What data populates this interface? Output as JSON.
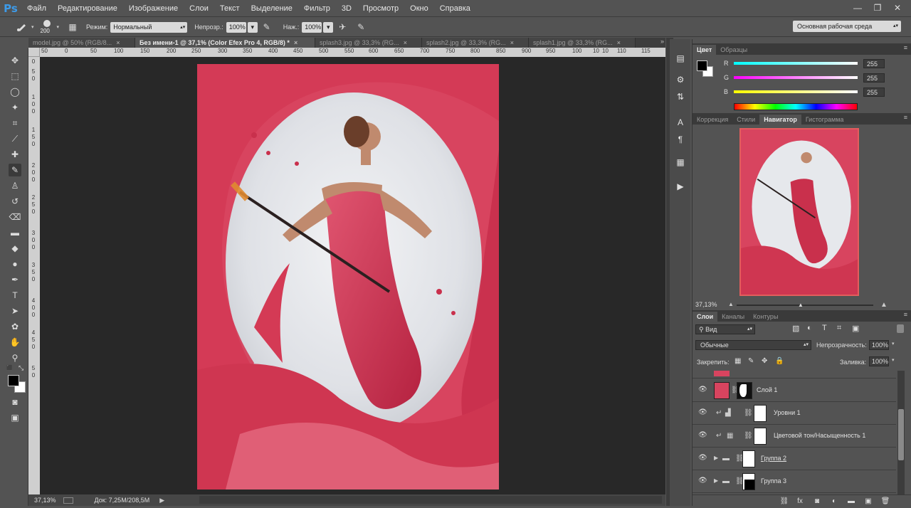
{
  "app": {
    "logo": "Ps"
  },
  "menu": [
    "Файл",
    "Редактирование",
    "Изображение",
    "Слои",
    "Текст",
    "Выделение",
    "Фильтр",
    "3D",
    "Просмотр",
    "Окно",
    "Справка"
  ],
  "window_controls": {
    "minimize": "—",
    "restore": "❐",
    "close": "✕"
  },
  "options": {
    "brush_size": "200",
    "mode_label": "Режим:",
    "mode_value": "Нормальный",
    "opacity_label": "Непрозр.:",
    "opacity_value": "100%",
    "flow_label": "Наж.:",
    "flow_value": "100%",
    "workspace": "Основная рабочая среда"
  },
  "tabs": [
    {
      "label": "model.jpg @ 50% (RGB/8...",
      "close": "×"
    },
    {
      "label": "Без имени-1 @ 37,1% (Color Efex Pro 4, RGB/8) *",
      "close": "×"
    },
    {
      "label": "splash3.jpg @ 33,3% (RG...",
      "close": "×"
    },
    {
      "label": "splash2.jpg @ 33,3% (RG...",
      "close": "×"
    },
    {
      "label": "splash1.jpg @ 33,3% (RG...",
      "close": "×"
    }
  ],
  "ruler_top": [
    "50",
    "0",
    "50",
    "100",
    "150",
    "200",
    "250",
    "300",
    "350",
    "400",
    "450",
    "500",
    "550",
    "600",
    "650",
    "700",
    "750",
    "800",
    "850",
    "900",
    "950",
    "100",
    "10",
    "10",
    "110",
    "115"
  ],
  "ruler_left": [
    "0",
    "5",
    "0",
    "1",
    "0",
    "0",
    "1",
    "5",
    "0",
    "2",
    "0",
    "0",
    "2",
    "5",
    "0",
    "3",
    "0",
    "0",
    "3",
    "5",
    "0",
    "4",
    "0",
    "0",
    "4",
    "5",
    "0",
    "5",
    "0"
  ],
  "status": {
    "zoom": "37,13%",
    "doc": "Док: 7,25M/208,5M",
    "arrow": "▶"
  },
  "color_panel": {
    "tabs": [
      "Цвет",
      "Образцы"
    ],
    "r_label": "R",
    "g_label": "G",
    "b_label": "B",
    "r": "255",
    "g": "255",
    "b": "255"
  },
  "nav_panel": {
    "tabs": [
      "Коррекция",
      "Стили",
      "Навигатор",
      "Гистограмма"
    ],
    "zoom": "37,13%"
  },
  "layers_panel": {
    "tabs": [
      "Слои",
      "Каналы",
      "Контуры"
    ],
    "filter_label": "Вид",
    "blend_mode": "Обычные",
    "opacity_label": "Непрозрачность:",
    "opacity": "100%",
    "lock_label": "Закрепить:",
    "fill_label": "Заливка:",
    "fill": "100%",
    "layers": [
      {
        "name": "Слой 1"
      },
      {
        "name": "Уровни 1"
      },
      {
        "name": "Цветовой тон/Насыщенность 1"
      },
      {
        "name": "Группа 2"
      },
      {
        "name": "Группа 3"
      }
    ]
  },
  "colors": {
    "accent": "#3d9be9",
    "splash": "#d43a55",
    "panel": "#535353"
  }
}
